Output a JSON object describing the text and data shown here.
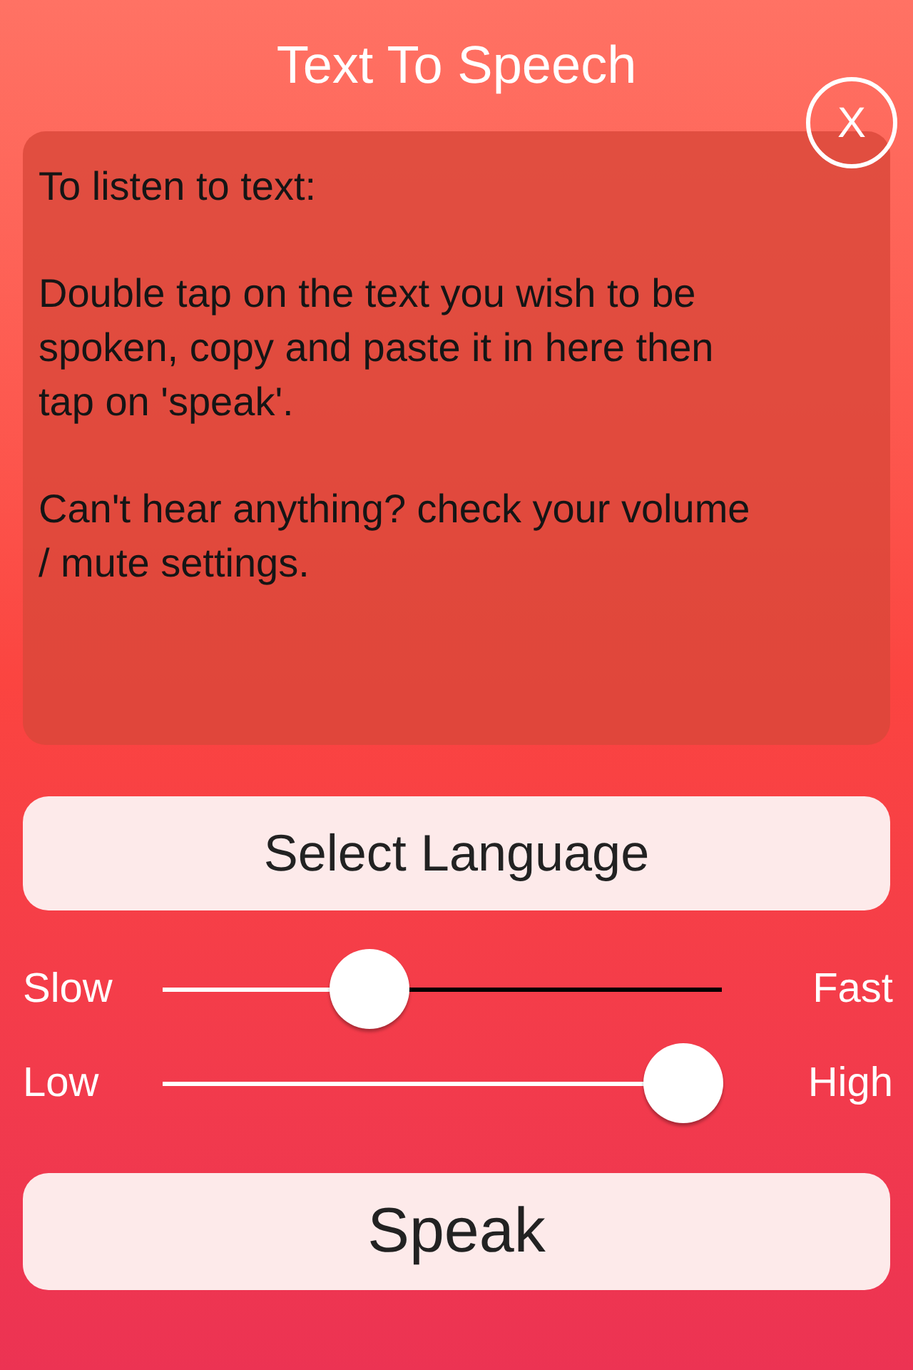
{
  "title": "Text To Speech",
  "close_button": {
    "label": "X"
  },
  "instructions": [
    "To listen to text:",
    "Double tap on the text you wish to be spoken, copy and paste it in here then tap on 'speak'.",
    "Can't hear anything? check your volume / mute settings."
  ],
  "language_button": {
    "label": "Select Language"
  },
  "sliders": [
    {
      "min_label": "Slow",
      "max_label": "Fast",
      "level": 0.37
    },
    {
      "min_label": "Low",
      "max_label": "High",
      "level": 0.93
    }
  ],
  "speak_button": {
    "label": "Speak"
  }
}
